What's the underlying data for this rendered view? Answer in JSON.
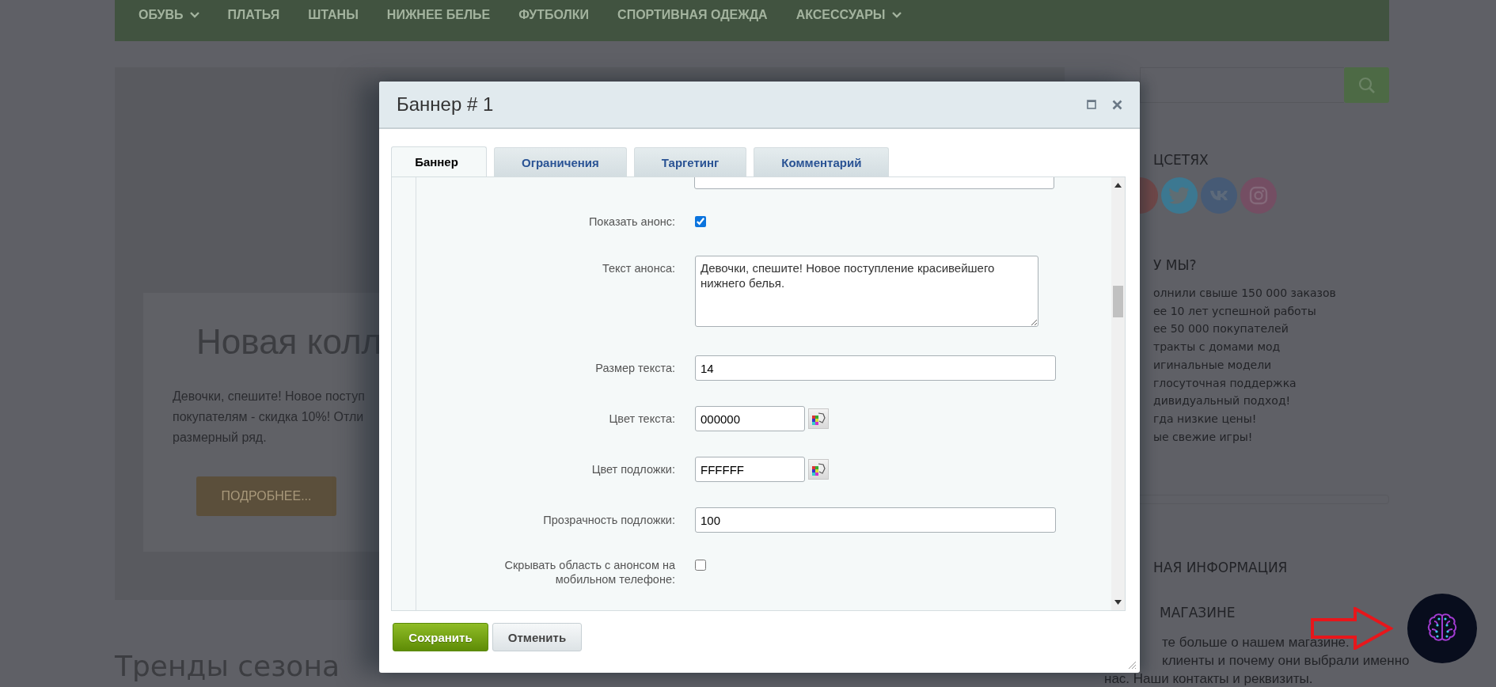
{
  "nav": {
    "items": [
      {
        "label": "ОБУВЬ",
        "dropdown": true
      },
      {
        "label": "ПЛАТЬЯ",
        "dropdown": false
      },
      {
        "label": "ШТАНЫ",
        "dropdown": false
      },
      {
        "label": "НИЖНЕЕ БЕЛЬЕ",
        "dropdown": false
      },
      {
        "label": "ФУТБОЛКИ",
        "dropdown": false
      },
      {
        "label": "СПОРТИВНАЯ ОДЕЖДА",
        "dropdown": false
      },
      {
        "label": "АКСЕССУАРЫ",
        "dropdown": true
      }
    ]
  },
  "banner": {
    "title": "Новая колл",
    "text_lines": [
      "Девочки, спешите! Новое поступ",
      "покупателям - скидка 10%! Отли",
      "размерный ряд."
    ],
    "button": "ПОДРОБНЕЕ..."
  },
  "section_heading": "Тренды сезона",
  "sidebar": {
    "social_heading": "ЦСЕТЯХ",
    "why_heading": "У МЫ?",
    "why_items": [
      "олнили свыше 150 000 заказов",
      "ее 10 лет успешной работы",
      "ее 50 000 покупателей",
      "тракты с домами мод",
      "игинальные модели",
      "глосуточная поддержка",
      "дивидуальный подход!",
      "гда низкие цены!",
      "ые свежие игры!"
    ],
    "info_heading": "НАЯ ИНФОРМАЦИЯ",
    "about_heading": "МАГАЗИНЕ",
    "about_lines": [
      "те больше о нашем магазине.",
      "клиенты и почему они выбрали именно",
      "нас. Наши контакты и реквизиты."
    ]
  },
  "dialog": {
    "title": "Баннер # 1",
    "tabs": [
      {
        "label": "Баннер",
        "selected": true
      },
      {
        "label": "Ограничения",
        "selected": false
      },
      {
        "label": "Таргетинг",
        "selected": false
      },
      {
        "label": "Комментарий",
        "selected": false
      }
    ],
    "rows": [
      {
        "kind": "checkbox",
        "label": "Показать анонс:",
        "checked": true
      },
      {
        "kind": "textarea",
        "label": "Текст анонса:",
        "value": "Девочки, спешите! Новое поступление красивейшего нижнего белья."
      },
      {
        "kind": "text",
        "label": "Размер текста:",
        "value": "14"
      },
      {
        "kind": "color",
        "label": "Цвет текста:",
        "value": "000000"
      },
      {
        "kind": "color",
        "label": "Цвет подложки:",
        "value": "FFFFFF"
      },
      {
        "kind": "text",
        "label": "Прозрачность подложки:",
        "value": "100"
      },
      {
        "kind": "checkbox",
        "label": "Скрывать область с анонсом на мобильном телефоне:",
        "checked": false
      }
    ],
    "buttons": [
      {
        "label": "Сохранить",
        "kind": "primary"
      },
      {
        "label": "Отменить",
        "kind": "secondary"
      }
    ]
  }
}
